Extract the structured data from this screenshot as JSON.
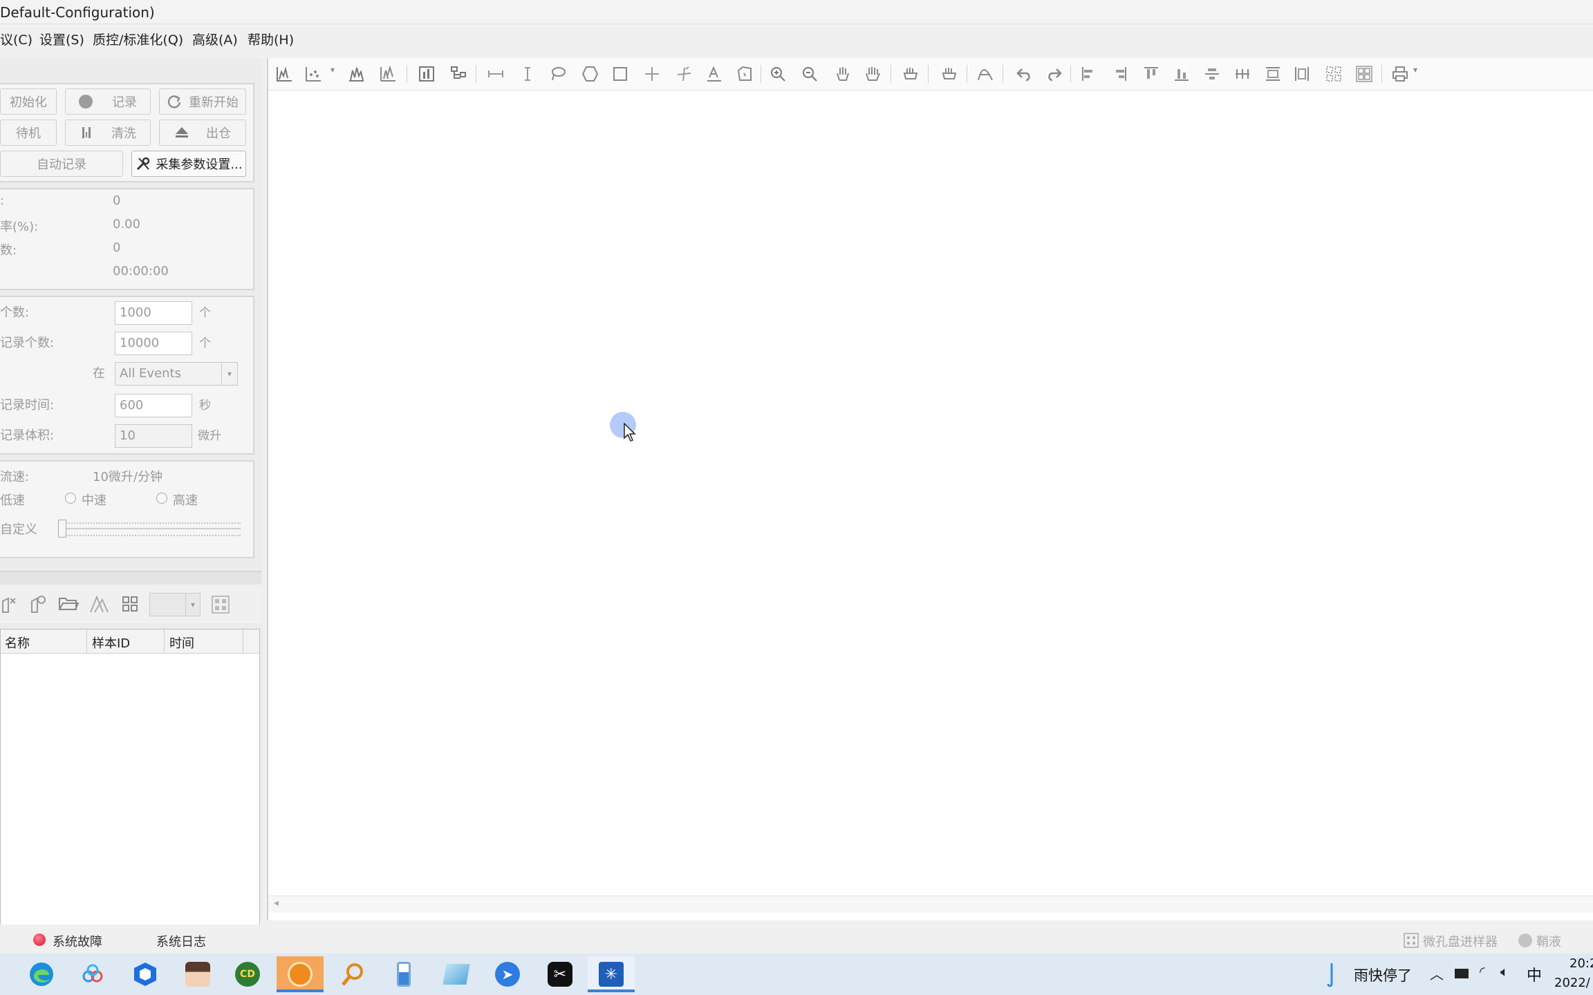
{
  "window": {
    "title": "Default-Configuration)"
  },
  "menu": [
    "议(C)",
    "设置(S)",
    "质控/标准化(Q)",
    "高级(A)",
    "帮助(H)"
  ],
  "acquisition_buttons": {
    "init": "初始化",
    "record": "记录",
    "restart": "重新开始",
    "standby": "待机",
    "clean": "清洗",
    "eject": "出仓",
    "auto_record": "自动记录",
    "acq_settings": "采集参数设置..."
  },
  "stats": {
    "rows": [
      {
        "label": ":",
        "value": "0"
      },
      {
        "label": "率(%):",
        "value": "0.00"
      },
      {
        "label": "数:",
        "value": "0"
      },
      {
        "label": "",
        "value": "00:00:00"
      }
    ]
  },
  "stop_conditions": {
    "count_label": "个数:",
    "count_value": "1000",
    "count_unit": "个",
    "record_count_label": "记录个数:",
    "record_count_value": "10000",
    "record_count_unit": "个",
    "in_label": "在",
    "gate_value": "All Events",
    "time_label": "记录时间:",
    "time_value": "600",
    "time_unit": "秒",
    "volume_label": "记录体积:",
    "volume_value": "10",
    "volume_unit": "微升"
  },
  "flow": {
    "rate_label": "流速:",
    "rate_value": "10微升/分钟",
    "low_label": "低速",
    "mid_label": "中速",
    "high_label": "高速",
    "custom_label": "自定义",
    "slider_level": 0
  },
  "sample_table": {
    "columns": [
      "名称",
      "样本ID",
      "时间"
    ],
    "rows": []
  },
  "status": {
    "fault": "系统故障",
    "log": "系统日志",
    "plate_loader": "微孔盘进样器",
    "sheath": "鞘液"
  },
  "taskbar": {
    "weather": "雨快停了",
    "ime": "中",
    "time": "20:2",
    "date": "2022/"
  },
  "colors": {
    "accent": "#3c7fd8",
    "fault": "#e0283c"
  }
}
